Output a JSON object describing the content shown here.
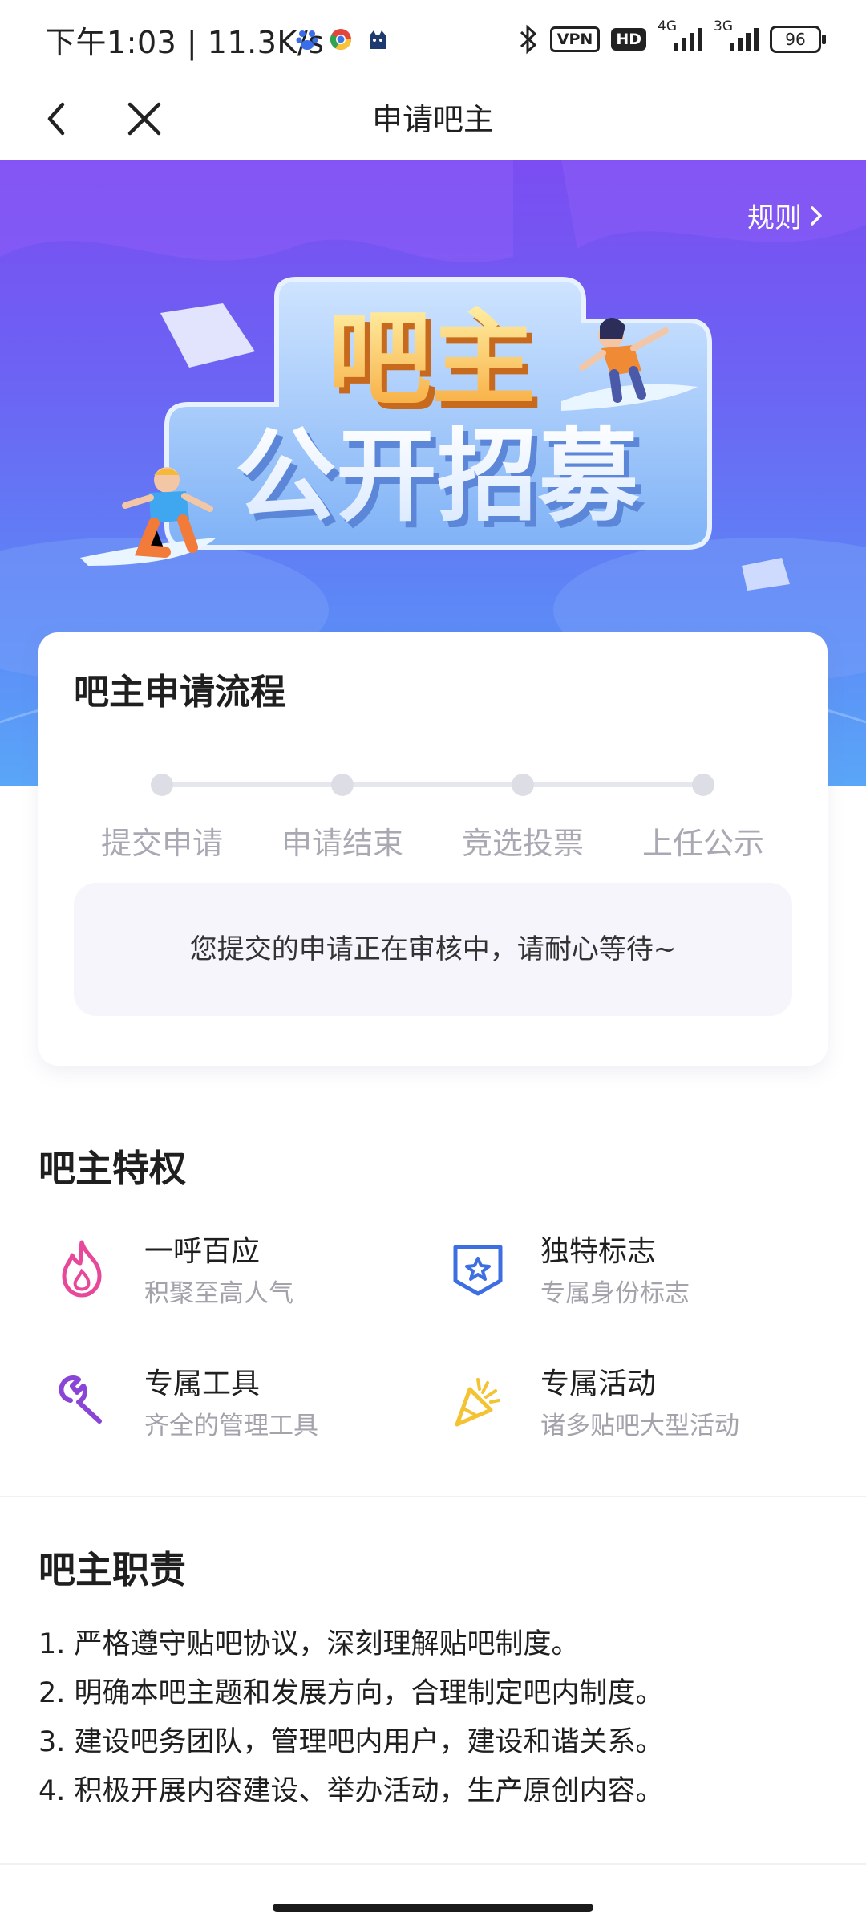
{
  "status_bar": {
    "time_speed": "下午1:03 | 11.3K/s",
    "vpn": "VPN",
    "hd": "HD",
    "net1": "4G",
    "net2": "3G",
    "battery": "96",
    "icons": [
      "baidu-icon",
      "chrome-icon",
      "cat-app-icon",
      "bluetooth-icon"
    ]
  },
  "nav": {
    "title": "申请吧主",
    "back_icon": "chevron-left-icon",
    "close_icon": "close-icon"
  },
  "banner": {
    "rules_label": "规则",
    "headline_line1": "吧主",
    "headline_line2": "公开招募"
  },
  "process": {
    "title": "吧主申请流程",
    "steps": [
      "提交申请",
      "申请结束",
      "竞选投票",
      "上任公示"
    ],
    "notice": "您提交的申请正在审核中，请耐心等待~"
  },
  "privileges": {
    "title": "吧主特权",
    "items": [
      {
        "title": "一呼百应",
        "desc": "积聚至高人气",
        "icon": "flame-icon",
        "color": "#e8489a"
      },
      {
        "title": "独特标志",
        "desc": "专属身份标志",
        "icon": "star-badge-icon",
        "color": "#3d6fe0"
      },
      {
        "title": "专属工具",
        "desc": "齐全的管理工具",
        "icon": "wrench-icon",
        "color": "#8a45d6"
      },
      {
        "title": "专属活动",
        "desc": "诸多贴吧大型活动",
        "icon": "party-popper-icon",
        "color": "#f3c333"
      }
    ]
  },
  "duties": {
    "title": "吧主职责",
    "items": [
      "1. 严格遵守贴吧协议，深刻理解贴吧制度。",
      "2. 明确本吧主题和发展方向，合理制定吧内制度。",
      "3. 建设吧务团队，管理吧内用户，建设和谐关系。",
      "4. 积极开展内容建设、举办活动，生产原创内容。"
    ]
  }
}
